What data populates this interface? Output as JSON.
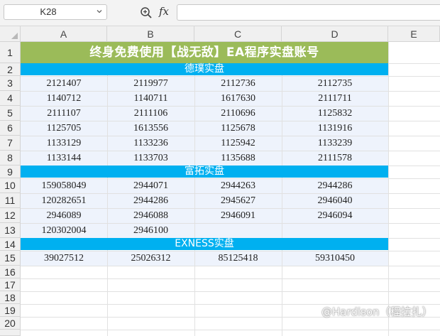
{
  "formula_bar": {
    "name_box": "K28",
    "fx_label": "fx",
    "formula_value": ""
  },
  "columns": [
    "A",
    "B",
    "C",
    "D",
    "E"
  ],
  "rows": [
    "1",
    "2",
    "3",
    "4",
    "5",
    "6",
    "7",
    "8",
    "9",
    "10",
    "11",
    "12",
    "13",
    "14",
    "15",
    "16",
    "17",
    "18",
    "19",
    "20"
  ],
  "sheet": {
    "title": "终身免费使用【战无敌】EA程序实盘账号",
    "sections": [
      {
        "header": "德璞实盘",
        "rows": [
          [
            "2121407",
            "2119977",
            "2112736",
            "2112735"
          ],
          [
            "1140712",
            "1140711",
            "1617630",
            "2111711"
          ],
          [
            "2111107",
            "2111106",
            "2110696",
            "1125832"
          ],
          [
            "1125705",
            "1613556",
            "1125678",
            "1131916"
          ],
          [
            "1133129",
            "1133236",
            "1125942",
            "1133239"
          ],
          [
            "1133144",
            "1133703",
            "1135688",
            "2111578"
          ]
        ]
      },
      {
        "header": "富拓实盘",
        "rows": [
          [
            "159058049",
            "2944071",
            "2944263",
            "2944286"
          ],
          [
            "120282651",
            "2944286",
            "2945627",
            "2946040"
          ],
          [
            "2946089",
            "2946088",
            "2946091",
            "2946094"
          ],
          [
            "120302004",
            "2946100",
            "",
            ""
          ]
        ]
      },
      {
        "header": "EXNESS实盘",
        "rows": [
          [
            "39027512",
            "25026312",
            "85125418",
            "59310450"
          ]
        ]
      }
    ]
  },
  "watermark": "@Hardison（程拉扎）",
  "colors": {
    "title_fill": "#9bbb59",
    "section_fill": "#00b0f0",
    "band_fill": "#eef3fc",
    "header_fill": "#f0f0f0",
    "grid_line": "#e1e1e1"
  }
}
